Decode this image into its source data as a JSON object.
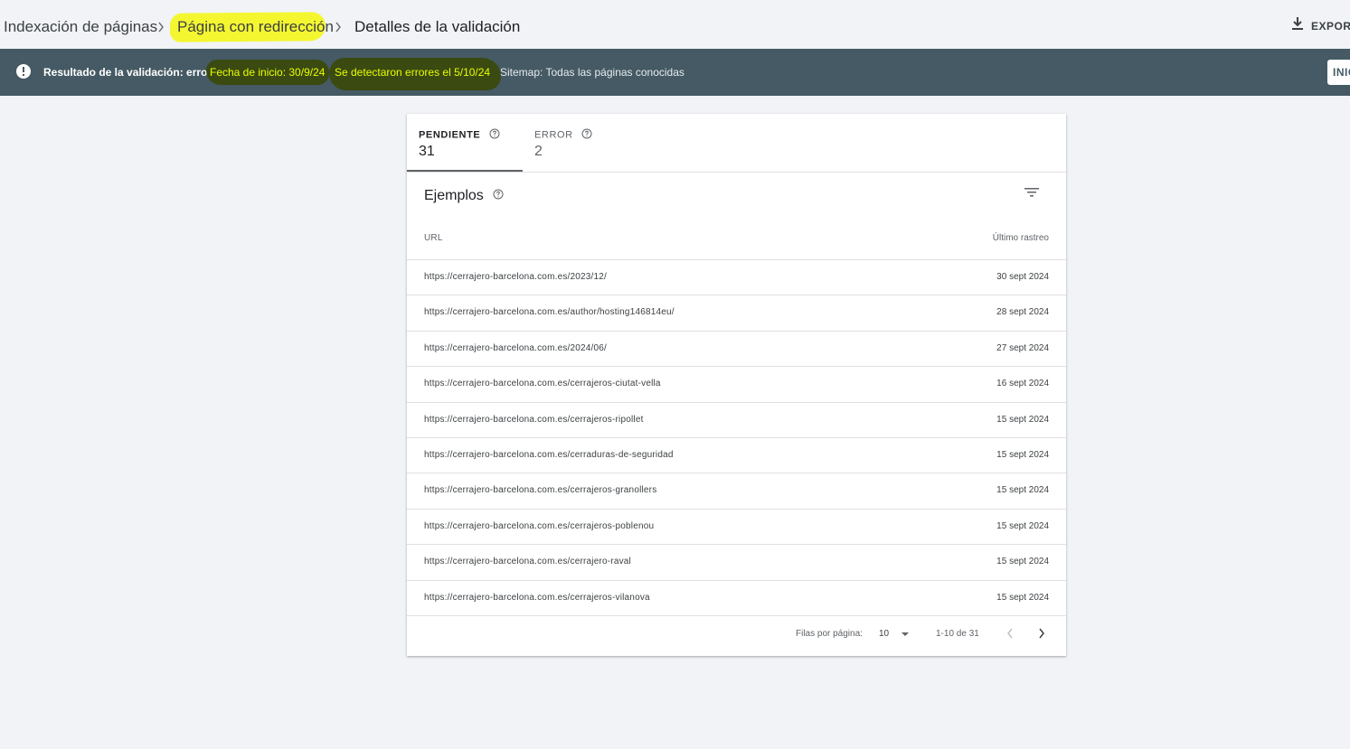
{
  "breadcrumb": {
    "items": [
      "Indexación de páginas",
      "Página con redirección",
      "Detalles de la validación"
    ]
  },
  "header": {
    "export_label": "EXPORT"
  },
  "banner": {
    "result": "Resultado de la validación: error",
    "start_date": "Fecha de inicio: 30/9/24",
    "errors_detected": "Se detectaron errores el 5/10/24",
    "sitemap": "Sitemap: Todas las páginas conocidas",
    "start_button": "INIC"
  },
  "tabs": [
    {
      "label": "PENDIENTE",
      "count": "31",
      "selected": true
    },
    {
      "label": "ERROR",
      "count": "2",
      "selected": false
    }
  ],
  "examples": {
    "title": "Ejemplos",
    "columns": {
      "url": "URL",
      "last_crawl": "Último rastreo"
    },
    "rows": [
      {
        "url": "https://cerrajero-barcelona.com.es/2023/12/",
        "date": "30 sept 2024"
      },
      {
        "url": "https://cerrajero-barcelona.com.es/author/hosting146814eu/",
        "date": "28 sept 2024"
      },
      {
        "url": "https://cerrajero-barcelona.com.es/2024/06/",
        "date": "27 sept 2024"
      },
      {
        "url": "https://cerrajero-barcelona.com.es/cerrajeros-ciutat-vella",
        "date": "16 sept 2024"
      },
      {
        "url": "https://cerrajero-barcelona.com.es/cerrajeros-ripollet",
        "date": "15 sept 2024"
      },
      {
        "url": "https://cerrajero-barcelona.com.es/cerraduras-de-seguridad",
        "date": "15 sept 2024"
      },
      {
        "url": "https://cerrajero-barcelona.com.es/cerrajeros-granollers",
        "date": "15 sept 2024"
      },
      {
        "url": "https://cerrajero-barcelona.com.es/cerrajeros-poblenou",
        "date": "15 sept 2024"
      },
      {
        "url": "https://cerrajero-barcelona.com.es/cerrajero-raval",
        "date": "15 sept 2024"
      },
      {
        "url": "https://cerrajero-barcelona.com.es/cerrajeros-vilanova",
        "date": "15 sept 2024"
      }
    ]
  },
  "pagination": {
    "rows_per_page_label": "Filas por página:",
    "rows_per_page": "10",
    "range": "1-10 de 31"
  },
  "colors": {
    "banner_bg": "#455a64",
    "highlight_yellow": "#f4f730",
    "page_bg": "#f1f3f6"
  },
  "icons": [
    "chevron-right-icon",
    "download-icon",
    "error-info-icon",
    "help-icon",
    "filter-icon",
    "dropdown-arrow-icon",
    "chevron-left-icon"
  ]
}
